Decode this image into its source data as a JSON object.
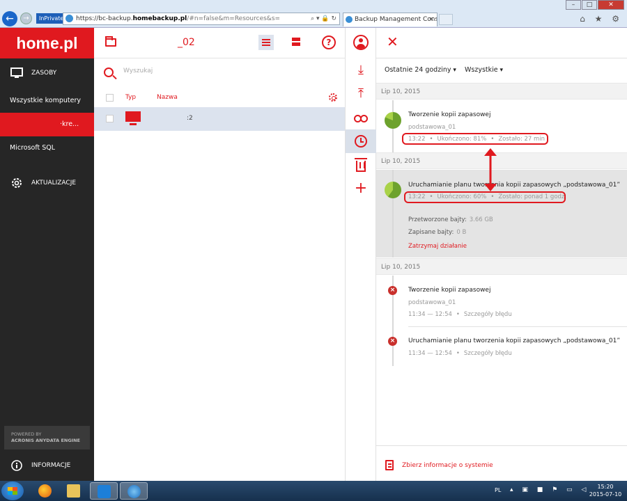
{
  "browser": {
    "inprivate": "InPrivate",
    "url_prefix": "https://bc-backup.",
    "url_domain": "homebackup.pl",
    "url_rest": "/#n=false&m=Resources&s=",
    "url_tools": "⌕ ▾ 🔒 ↻",
    "tab_title": "Backup Management Cons...",
    "tab_close": "×",
    "min": "–",
    "max": "□",
    "close": "✕",
    "right_icons": "⌂ ★ ⚙"
  },
  "sidebar": {
    "logo": "home.pl",
    "sections": {
      "resources": "ZASOBY",
      "updates": "AKTUALIZACJE",
      "info": "INFORMACJE"
    },
    "items": [
      {
        "label": "Wszystkie komputery"
      },
      {
        "label": "·kre..."
      },
      {
        "label": "Microsoft SQL"
      }
    ],
    "powered_line1": "POWERED BY",
    "powered_line2": "ACRONIS ANYDATA ENGINE"
  },
  "resources": {
    "name": "_02",
    "search_placeholder": "Wyszukaj",
    "help": "?",
    "columns": {
      "type": "Typ",
      "name": "Nazwa"
    },
    "rows": [
      {
        "name": ":2"
      }
    ]
  },
  "toolbar": {
    "download": "⤓",
    "upload": "⤒",
    "add": "+"
  },
  "panel": {
    "close": "✕",
    "filter_period": "Ostatnie 24 godziny",
    "filter_type": "Wszystkie",
    "groups": [
      {
        "date": "Lip 10, 2015",
        "entries": [
          {
            "title": "Tworzenie kopii zapasowej",
            "subtitle": "podstawowa_01",
            "time": "13:22",
            "progress_text": "Ukończono: 81%",
            "remaining": "Zostało: 27 min",
            "progress": 0.81
          }
        ]
      },
      {
        "date": "Lip 10, 2015",
        "entries": [
          {
            "title": "Uruchamianie planu tworzenia kopii zapasowych „podstawowa_01”",
            "time": "13:22",
            "progress_text": "Ukończono: 60%",
            "remaining": "Zostało: ponad 1 godz.",
            "progress": 0.6,
            "processed_label": "Przetworzone bajty:",
            "processed_value": "3.66 GB",
            "saved_label": "Zapisane bajty:",
            "saved_value": "0 B",
            "stop": "Zatrzymaj działanie"
          }
        ]
      },
      {
        "date": "Lip 10, 2015",
        "entries": [
          {
            "title": "Tworzenie kopii zapasowej",
            "subtitle": "podstawowa_01",
            "time": "11:34 — 12:54",
            "details": "Szczegóły błędu"
          },
          {
            "title": "Uruchamianie planu tworzenia kopii zapasowych „podstawowa_01”",
            "time": "11:34 — 12:54",
            "details": "Szczegóły błędu"
          }
        ]
      }
    ],
    "error_glyph": "×",
    "separator": "•",
    "footer_link": "Zbierz informacje o systemie"
  },
  "taskbar": {
    "lang": "PL",
    "tray_icons": "▴ ▣ ■ ⚑ ▭ ◁",
    "time": "15:20",
    "date": "2015-07-10"
  },
  "colors": {
    "brand_red": "#e0191f",
    "sidebar_bg": "#262626",
    "progress_green": "#a9d248",
    "error_red": "#c9302c"
  }
}
